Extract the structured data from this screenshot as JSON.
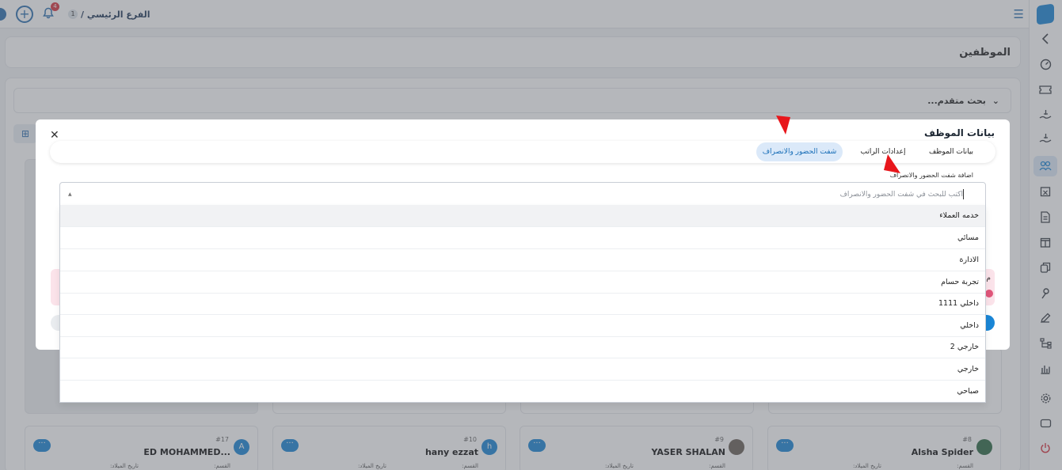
{
  "topbar": {
    "branch_count": "1",
    "branch_label": "الفرع الرئيسي /",
    "notification_count": "4",
    "plus_glyph": "+"
  },
  "page": {
    "title": "الموظفين"
  },
  "search": {
    "advanced_label": "بحث متقدم..."
  },
  "cards": [
    {
      "num": "#17",
      "name": "ED MOHAMMED...",
      "avatar": "A",
      "dept_label": "القسم:",
      "birth_label": "تاريخ الميلاد:"
    },
    {
      "num": "#10",
      "name": "hany ezzat",
      "avatar": "h",
      "dept_label": "القسم:",
      "birth_label": "تاريخ الميلاد:"
    },
    {
      "num": "#9",
      "name": "YASER SHALAN",
      "avatar": "",
      "dept_label": "القسم:",
      "birth_label": "تاريخ الميلاد:"
    },
    {
      "num": "#8",
      "name": "Alsha Spider",
      "avatar": "",
      "dept_label": "القسم:",
      "birth_label": "تاريخ الميلاد:"
    }
  ],
  "card_menu_glyph": "···",
  "modal": {
    "title": "بيانات الموظف",
    "close_glyph": "✕",
    "tabs": [
      "بيانات الموظف",
      "إعدادات الراتب",
      "شفت الحضور والانصراف"
    ],
    "active_tab": 2,
    "add_shift_label": "اضافة شفت الحضور والانصراف",
    "pink_letter": "م"
  },
  "shift_select": {
    "placeholder": "اكتب للبحث في شفت الحضور والانصراف",
    "arrow_glyph": "▲",
    "options": [
      "خدمه العملاء",
      "مسائي",
      "الادارة",
      "تجربة حسام",
      "داخلي 1111",
      "داخلي",
      "خارجي 2",
      "خارجي",
      "صباحي"
    ],
    "hovered_index": 0
  },
  "sidebar": {
    "icons": [
      "chevron-left-icon",
      "dashboard-gauge-icon",
      "ticket-icon",
      "money-hand-icon",
      "money-hand-icon-2",
      "users-icon",
      "calendar-x-icon",
      "document-icon",
      "gift-icon",
      "copy-icon",
      "map-pin-icon",
      "pen-icon",
      "hierarchy-icon",
      "bar-chart-icon",
      "gear-icon",
      "display-icon",
      "power-icon"
    ],
    "active_index": 5
  },
  "colors": {
    "brand": "#1a86d6",
    "active_tab_bg": "#dbe9f9",
    "annotation_arrow": "#e8161b",
    "danger": "#d8333e"
  }
}
